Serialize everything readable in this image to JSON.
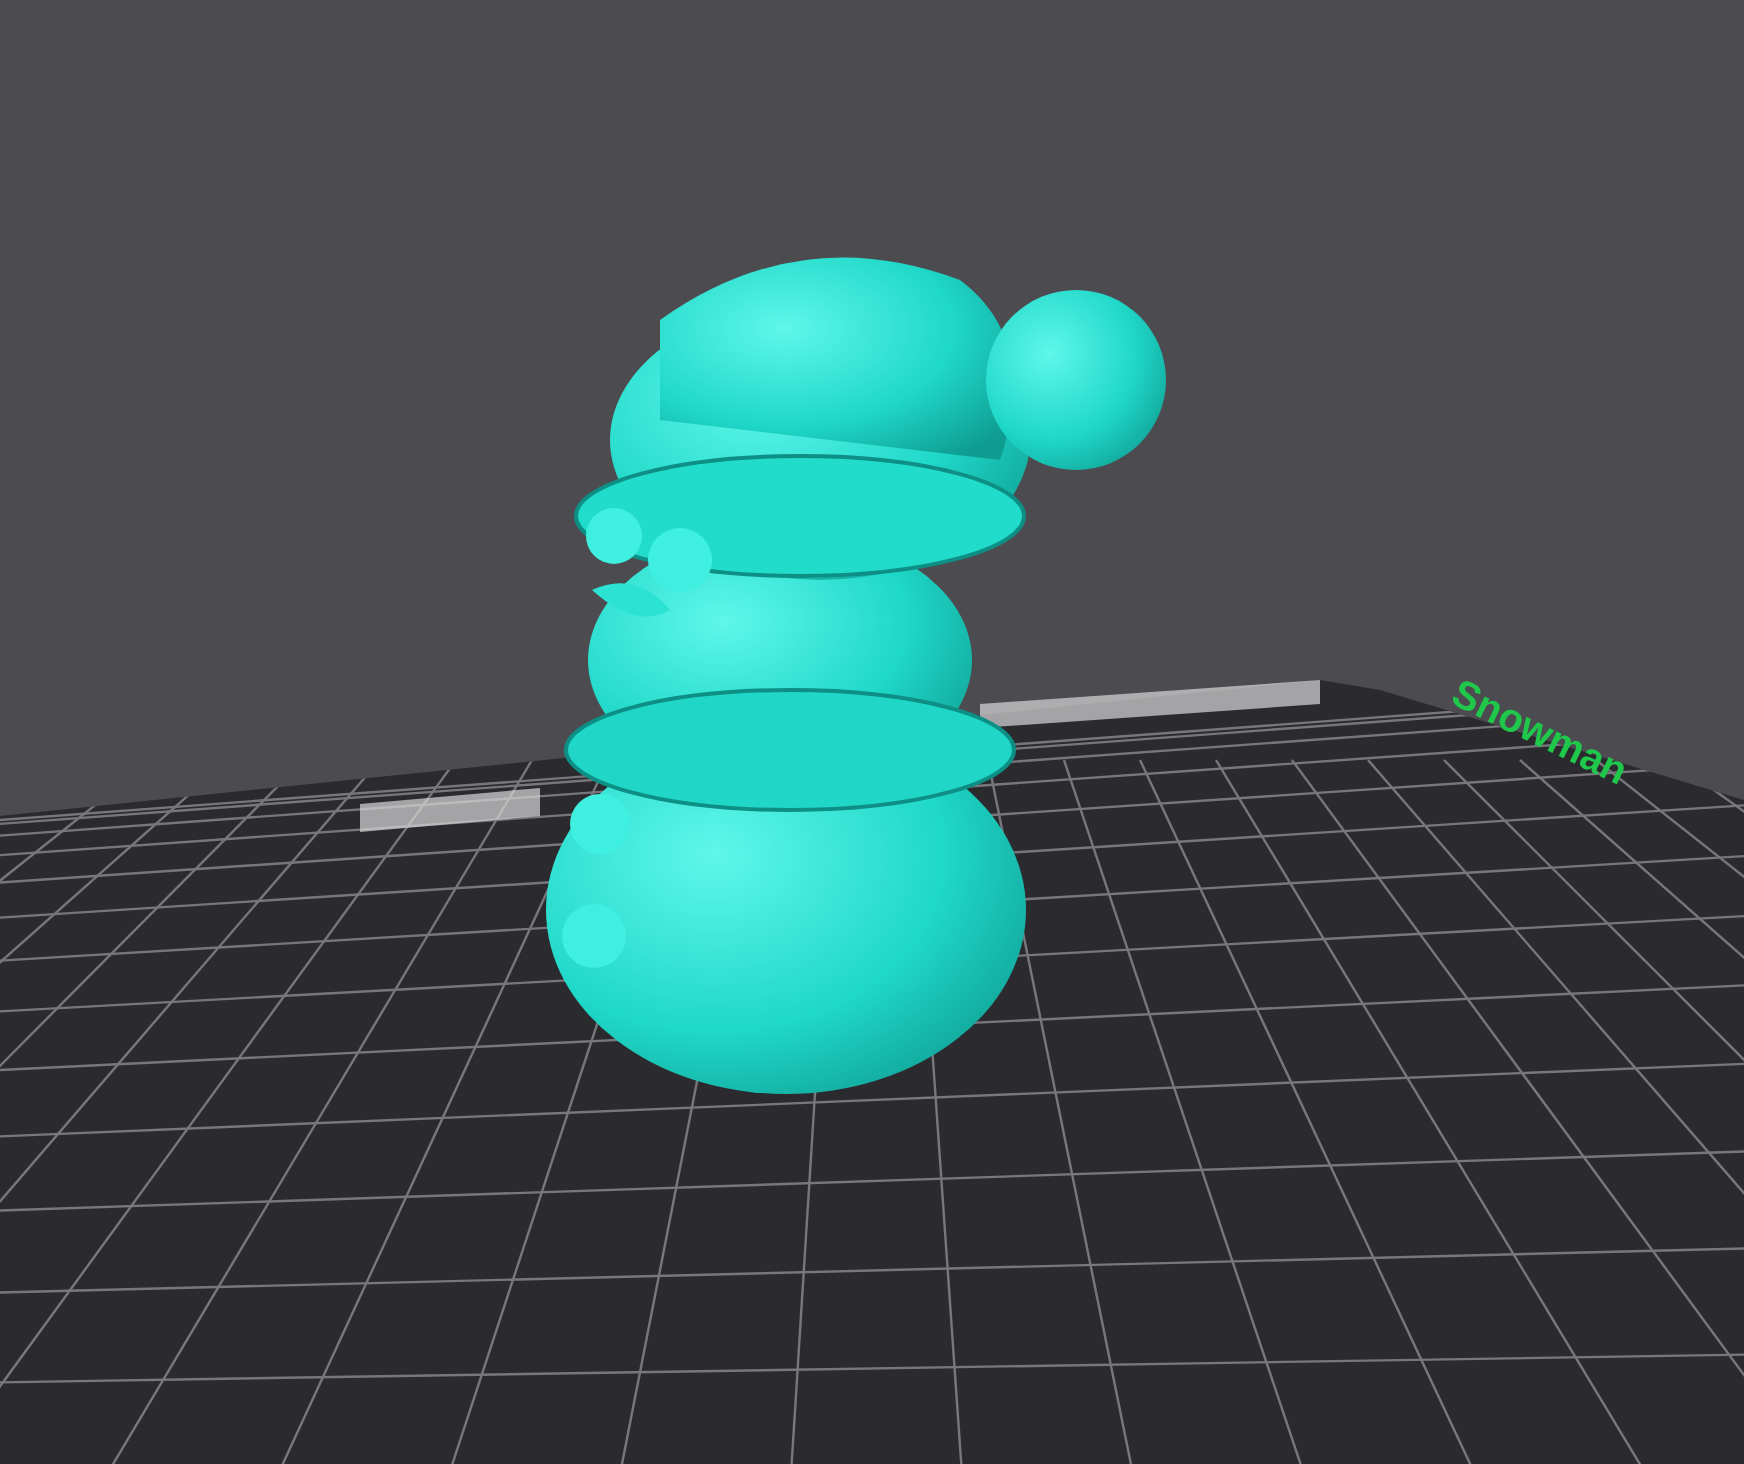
{
  "viewport": {
    "object_label": "Snowman"
  }
}
